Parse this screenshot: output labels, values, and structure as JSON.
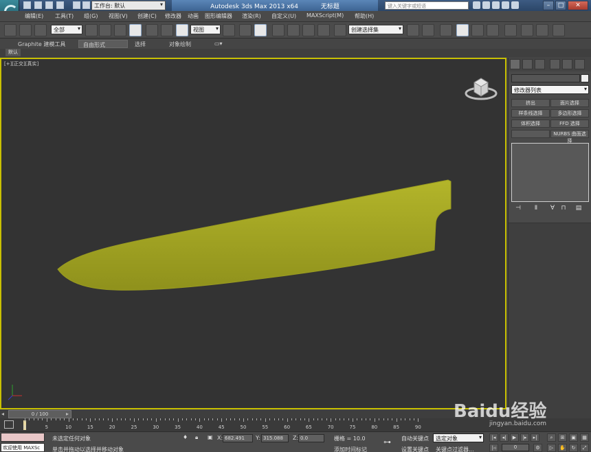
{
  "titlebar": {
    "workspace_label": "工作台: 默认",
    "app_title": "Autodesk 3ds Max  2013 x64",
    "doc_title": "无标题",
    "search_placeholder": "键入关键字或短语"
  },
  "menus": [
    "编辑(E)",
    "工具(T)",
    "组(G)",
    "视图(V)",
    "创建(C)",
    "修改器",
    "动画",
    "图形编辑器",
    "渲染(R)",
    "自定义(U)",
    "MAXScript(M)",
    "帮助(H)"
  ],
  "toolbar": {
    "selection_filter": "全部",
    "ref_coord": "视图",
    "selection_set": "创建选择集"
  },
  "ribbon": {
    "tabs": [
      "Graphite 建模工具",
      "自由形式",
      "选择",
      "对象绘制"
    ],
    "active_tab": 1,
    "sub_label": "默认"
  },
  "viewport": {
    "label": "[+][正交][真实]",
    "object_color": "#a6a823",
    "border_color": "#c8c000"
  },
  "command_panel": {
    "modifier_list": "修改器列表",
    "modifier_buttons": [
      "挤出",
      "面片选择",
      "样条线选择",
      "多边形选择",
      "体积选择",
      "FFD 选择",
      "",
      "NURBS 曲面选择"
    ]
  },
  "timeline": {
    "frame_label": "0 / 100",
    "ticks": [
      0,
      5,
      10,
      15,
      20,
      25,
      30,
      35,
      40,
      45,
      50,
      55,
      60,
      65,
      70,
      75,
      80,
      85,
      90
    ]
  },
  "status": {
    "welcome": "欢迎使用 MAXSc",
    "selection_status": "未选定任何对象",
    "prompt": "单击并拖动以选择并移动对象",
    "x_label": "X:",
    "x_value": "682.491",
    "y_label": "Y:",
    "y_value": "315.088",
    "z_label": "Z:",
    "z_value": "0.0",
    "grid": "栅格 = 10.0",
    "auto_key": "自动关键点",
    "set_key": "设置关键点",
    "selection_dd": "选定对象",
    "key_filter": "关键点过滤器...",
    "add_time_tag": "添加时间标记",
    "frame_value": "0"
  },
  "watermark": {
    "text": "Baidu经验",
    "url": "jingyan.baidu.com"
  }
}
